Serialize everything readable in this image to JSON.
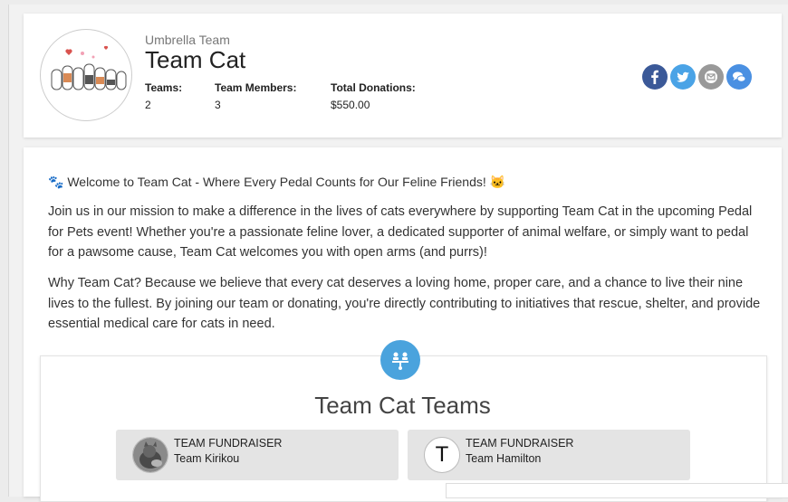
{
  "header": {
    "supertitle": "Umbrella Team",
    "title": "Team Cat",
    "stats": [
      {
        "label": "Teams:",
        "value": "2"
      },
      {
        "label": "Team Members:",
        "value": "3"
      },
      {
        "label": "Total Donations:",
        "value": "$550.00"
      }
    ],
    "social": [
      "facebook-icon",
      "twitter-icon",
      "email-icon",
      "chat-icon"
    ]
  },
  "content": {
    "welcome": "🐾 Welcome to Team Cat - Where Every Pedal Counts for Our Feline Friends! 🐱",
    "paragraph1": "Join us in our mission to make a difference in the lives of cats everywhere by supporting Team Cat in the upcoming Pedal for Pets event! Whether you're a passionate feline lover, a dedicated supporter of animal welfare, or simply want to pedal for a pawsome cause, Team Cat welcomes you with open arms (and purrs)!",
    "paragraph2": "Why Team Cat? Because we believe that every cat deserves a loving home, proper care, and a chance to live their nine lives to the fullest. By joining our team or donating, you're directly contributing to initiatives that rescue, shelter, and provide essential medical care for cats in need."
  },
  "teams": {
    "title": "Team Cat Teams",
    "items": [
      {
        "kind": "TEAM FUNDRAISER",
        "name": "Team Kirikou",
        "avatar": "photo"
      },
      {
        "kind": "TEAM FUNDRAISER",
        "name": "Team Hamilton",
        "avatar_letter": "T"
      }
    ]
  },
  "colors": {
    "facebook": "#3b5998",
    "twitter": "#4aa3e6",
    "email": "#999999",
    "chat": "#4a90e2",
    "teams_icon": "#4aa3dd"
  }
}
